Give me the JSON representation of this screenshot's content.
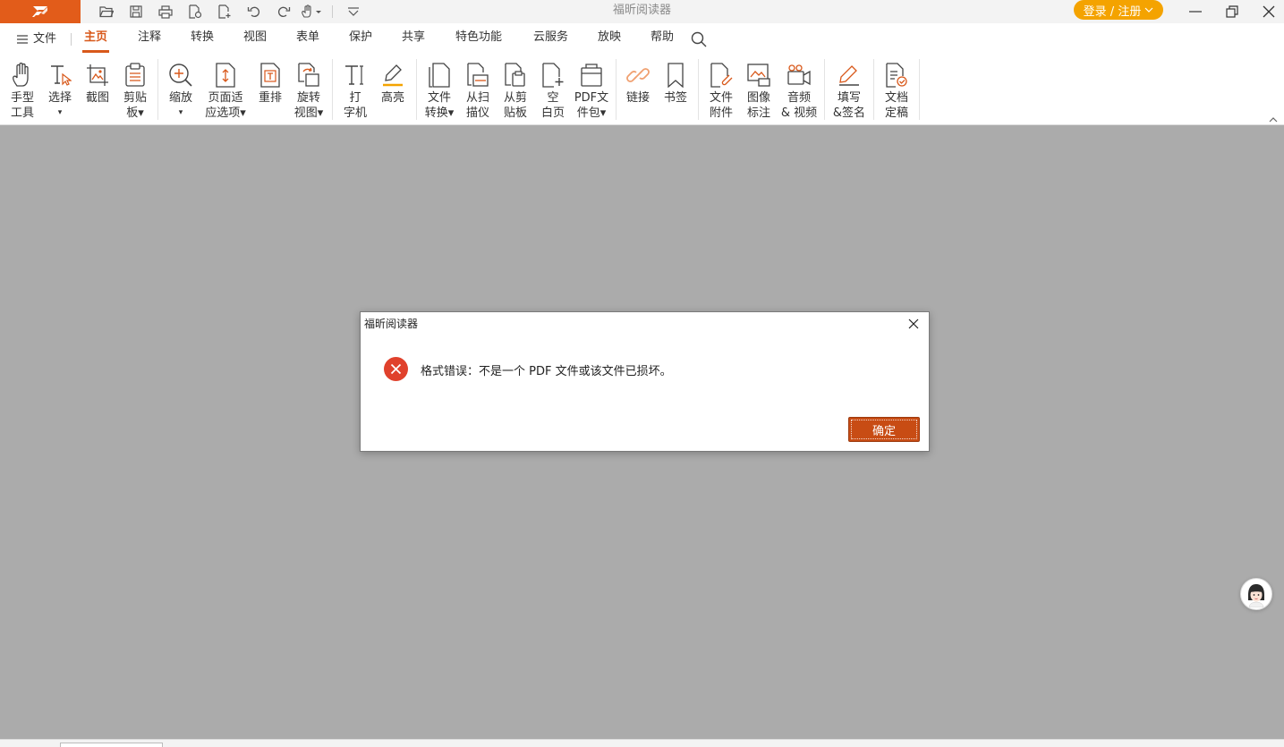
{
  "app": {
    "title": "福昕阅读器",
    "brand_color": "#e25c1a",
    "accent_color": "#d8581a"
  },
  "quick_access": {
    "icons": [
      "open-folder-icon",
      "save-icon",
      "print-icon",
      "properties-icon",
      "new-file-icon",
      "undo-icon",
      "redo-icon",
      "hand-tool-icon",
      "customize-icon"
    ]
  },
  "login": {
    "label": "登录 / 注册"
  },
  "menu": {
    "file_label": "文件",
    "tabs": [
      "主页",
      "注释",
      "转换",
      "视图",
      "表单",
      "保护",
      "共享",
      "特色功能",
      "云服务",
      "放映",
      "帮助"
    ],
    "active_tab": "主页"
  },
  "ribbon": {
    "buttons": [
      {
        "line1": "手型",
        "line2": "工具",
        "icon": "hand-icon"
      },
      {
        "line1": "选择",
        "line2": "▾",
        "icon": "select-text-icon"
      },
      {
        "line1": "截图",
        "line2": "",
        "icon": "screenshot-icon"
      },
      {
        "line1": "剪贴",
        "line2": "板▾",
        "icon": "clipboard-icon"
      },
      {
        "line1": "缩放",
        "line2": "▾",
        "icon": "zoom-icon"
      },
      {
        "line1": "页面适",
        "line2": "应选项▾",
        "icon": "fit-page-icon"
      },
      {
        "line1": "重排",
        "line2": "",
        "icon": "reflow-icon"
      },
      {
        "line1": "旋转",
        "line2": "视图▾",
        "icon": "rotate-icon"
      },
      {
        "line1": "打",
        "line2": "字机",
        "icon": "typewriter-icon"
      },
      {
        "line1": "高亮",
        "line2": "",
        "icon": "highlight-icon"
      },
      {
        "line1": "文件",
        "line2": "转换▾",
        "icon": "file-convert-icon"
      },
      {
        "line1": "从扫",
        "line2": "描仪",
        "icon": "scanner-icon"
      },
      {
        "line1": "从剪",
        "line2": "贴板",
        "icon": "from-clipboard-icon"
      },
      {
        "line1": "空",
        "line2": "白页",
        "icon": "blank-page-icon"
      },
      {
        "line1": "PDF文",
        "line2": "件包▾",
        "icon": "pdf-portfolio-icon"
      },
      {
        "line1": "链接",
        "line2": "",
        "icon": "link-icon"
      },
      {
        "line1": "书签",
        "line2": "",
        "icon": "bookmark-icon"
      },
      {
        "line1": "文件",
        "line2": "附件",
        "icon": "attachment-icon"
      },
      {
        "line1": "图像",
        "line2": "标注",
        "icon": "image-annotation-icon"
      },
      {
        "line1": "音频",
        "line2": "& 视频",
        "icon": "audio-video-icon"
      },
      {
        "line1": "填写",
        "line2": "&签名",
        "icon": "fill-sign-icon"
      },
      {
        "line1": "文档",
        "line2": "定稿",
        "icon": "finalize-doc-icon"
      }
    ]
  },
  "dialog": {
    "title": "福昕阅读器",
    "message": "格式错误：不是一个 PDF 文件或该文件已损坏。",
    "ok_label": "确定",
    "icon": "error-icon"
  }
}
